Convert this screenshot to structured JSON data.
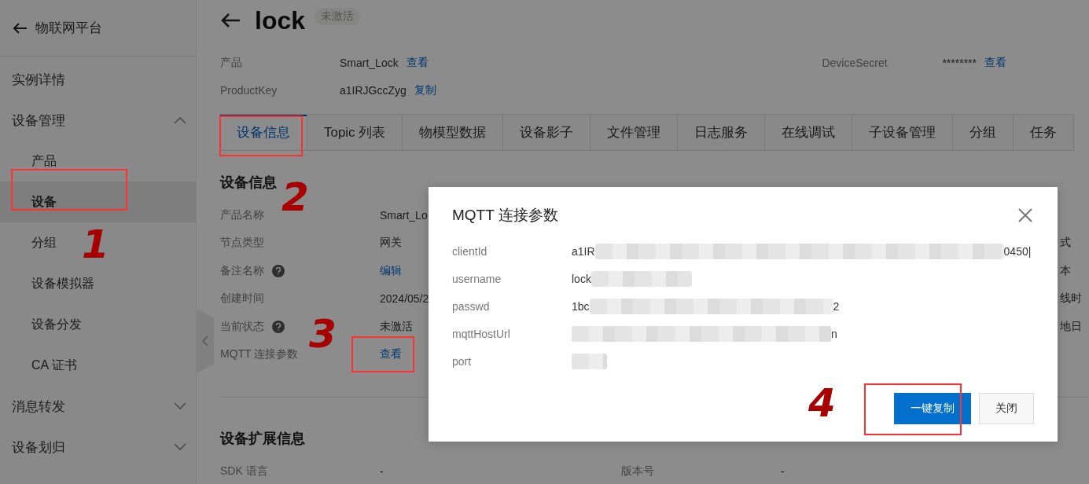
{
  "sidebar": {
    "back_title": "物联网平台",
    "items": [
      {
        "label": "实例详情",
        "selected": false
      },
      {
        "label": "设备管理",
        "expanded": true,
        "selected": false,
        "children": [
          {
            "label": "产品",
            "selected": false
          },
          {
            "label": "设备",
            "selected": true
          },
          {
            "label": "分组",
            "selected": false
          },
          {
            "label": "设备模拟器",
            "selected": false
          },
          {
            "label": "设备分发",
            "selected": false
          },
          {
            "label": "CA 证书",
            "selected": false
          }
        ]
      },
      {
        "label": "消息转发",
        "expanded": false,
        "selected": false
      },
      {
        "label": "设备划归",
        "expanded": false,
        "selected": false
      }
    ]
  },
  "header": {
    "title": "lock",
    "status": "未激活"
  },
  "summary": [
    {
      "label": "产品",
      "value": "Smart_Lock",
      "action": "查看",
      "label2": "DeviceSecret",
      "value2": "********",
      "action2": "查看"
    },
    {
      "label": "ProductKey",
      "value": "a1IRJGccZyg",
      "action": "复制"
    }
  ],
  "tabs": [
    {
      "label": "设备信息",
      "selected": true
    },
    {
      "label": "Topic 列表",
      "selected": false
    },
    {
      "label": "物模型数据",
      "selected": false
    },
    {
      "label": "设备影子",
      "selected": false
    },
    {
      "label": "文件管理",
      "selected": false
    },
    {
      "label": "日志服务",
      "selected": false
    },
    {
      "label": "在线调试",
      "selected": false
    },
    {
      "label": "子设备管理",
      "selected": false
    },
    {
      "label": "分组",
      "selected": false
    },
    {
      "label": "任务",
      "selected": false
    }
  ],
  "device_info": {
    "title": "设备信息",
    "rows": [
      {
        "label": "产品名称",
        "value": "Smart_Lo",
        "kind": "text",
        "help": false
      },
      {
        "label": "节点类型",
        "value": "网关",
        "kind": "text",
        "help": false,
        "right": "式"
      },
      {
        "label": "备注名称",
        "value": "编辑",
        "kind": "link",
        "help": true,
        "right": "本"
      },
      {
        "label": "创建时间",
        "value": "2024/05/2",
        "kind": "text",
        "help": false,
        "right": "线时"
      },
      {
        "label": "当前状态",
        "value": "未激活",
        "kind": "text",
        "help": true,
        "right": "地日"
      },
      {
        "label": "MQTT 连接参数",
        "value": "查看",
        "kind": "link",
        "help": false
      }
    ]
  },
  "extended_info": {
    "title": "设备扩展信息",
    "rows": [
      {
        "label": "SDK 语言",
        "value": "-",
        "label2": "版本号",
        "value2": "-"
      }
    ]
  },
  "dialog": {
    "title": "MQTT 连接参数",
    "rows": [
      {
        "label": "clientId",
        "prefix": "a1IR",
        "suffix": "0450|"
      },
      {
        "label": "username",
        "prefix": "lock"
      },
      {
        "label": "passwd",
        "prefix": "1bc",
        "suffix": "2"
      },
      {
        "label": "mqttHostUrl",
        "suffix": "n"
      },
      {
        "label": "port"
      }
    ],
    "buttons": [
      {
        "label": "一键复制",
        "kind": "primary"
      },
      {
        "label": "关闭",
        "kind": "default"
      }
    ]
  },
  "annotations": [
    {
      "kind": "box"
    },
    {
      "kind": "box"
    },
    {
      "kind": "box"
    },
    {
      "kind": "box"
    },
    {
      "kind": "number",
      "text": "1"
    },
    {
      "kind": "number",
      "text": "2"
    },
    {
      "kind": "number",
      "text": "3"
    },
    {
      "kind": "number",
      "text": "4"
    }
  ]
}
